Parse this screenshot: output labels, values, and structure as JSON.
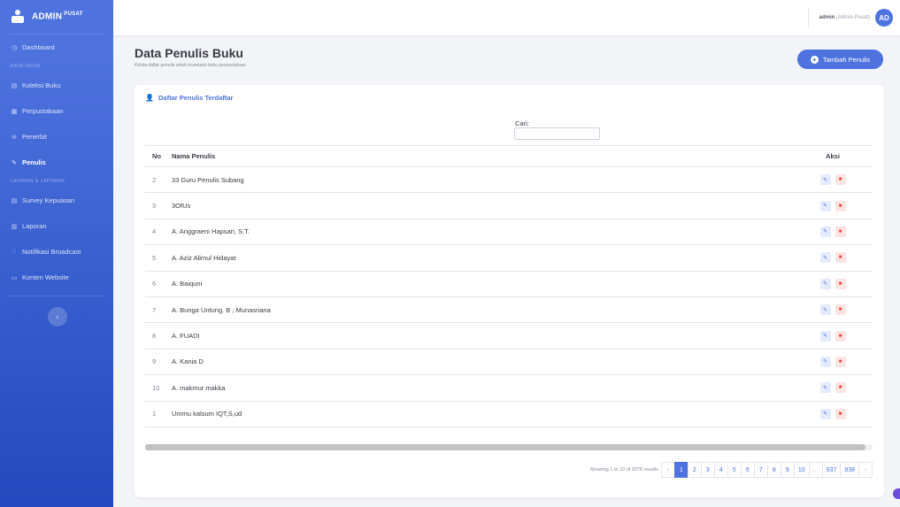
{
  "sidebar": {
    "brand": "ADMIN",
    "brand_sup": "PUSAT",
    "items": [
      {
        "type": "item",
        "label": "Dashboard",
        "icon": "dashboard-icon",
        "glyph": "◷"
      },
      {
        "type": "heading",
        "label": "DATA INDUK"
      },
      {
        "type": "item",
        "label": "Koleksi Buku",
        "icon": "book-icon",
        "glyph": "▤"
      },
      {
        "type": "item",
        "label": "Perpustakaan",
        "icon": "library-icon",
        "glyph": "▦"
      },
      {
        "type": "item",
        "label": "Penerbit",
        "icon": "publisher-icon",
        "glyph": "⊖"
      },
      {
        "type": "item",
        "label": "Penulis",
        "icon": "pen-icon",
        "glyph": "✎",
        "active": true
      },
      {
        "type": "heading",
        "label": "LAYANAN & LAPORAN"
      },
      {
        "type": "item",
        "label": "Survey Kepuasan",
        "icon": "survey-icon",
        "glyph": "▤"
      },
      {
        "type": "item",
        "label": "Laporan",
        "icon": "report-icon",
        "glyph": "▥"
      },
      {
        "type": "item",
        "label": "Notifikasi Broadcast",
        "icon": "bell-icon",
        "glyph": "◌"
      },
      {
        "type": "item",
        "label": "Konten Website",
        "icon": "content-icon",
        "glyph": "▭"
      }
    ],
    "collapse_glyph": "‹"
  },
  "topbar": {
    "user_name": "admin",
    "user_role": "(Admin Pusat)",
    "avatar_text": "AD"
  },
  "page": {
    "title": "Data Penulis Buku",
    "subtitle": "Kelola daftar penulis untuk inventaris buku perpustakaan.",
    "add_button": "Tambah Penulis"
  },
  "card": {
    "header": "Daftar Penulis Terdaftar",
    "search_label": "Cari:",
    "search_value": ""
  },
  "table": {
    "columns": {
      "no": "No",
      "name": "Nama Penulis",
      "aksi": "Aksi"
    },
    "rows": [
      {
        "no": "2",
        "name": "33 Guru Penulis Subang"
      },
      {
        "no": "3",
        "name": "3OfUs"
      },
      {
        "no": "4",
        "name": "A. Anggraeni Hapsari, S.T."
      },
      {
        "no": "5",
        "name": "A. Aziz Alimul Hidayat"
      },
      {
        "no": "6",
        "name": "A. Baiquni"
      },
      {
        "no": "7",
        "name": "A. Bunga Untung. B ; Munasriana"
      },
      {
        "no": "8",
        "name": "A. FUADI"
      },
      {
        "no": "9",
        "name": "A. Kania D"
      },
      {
        "no": "10",
        "name": "A. makmur makka"
      },
      {
        "no": "1",
        "name": "Ummu kalsum IQT,S,ud"
      }
    ]
  },
  "pagination": {
    "showing": "Showing 1 to 10 of 9378 results",
    "prev": "‹",
    "pages": [
      "1",
      "2",
      "3",
      "4",
      "5",
      "6",
      "7",
      "8",
      "9",
      "10",
      "...",
      "937",
      "938"
    ],
    "active": "1",
    "next": "›"
  },
  "colors": {
    "primary": "#4e73df",
    "danger": "#e74a3b"
  }
}
